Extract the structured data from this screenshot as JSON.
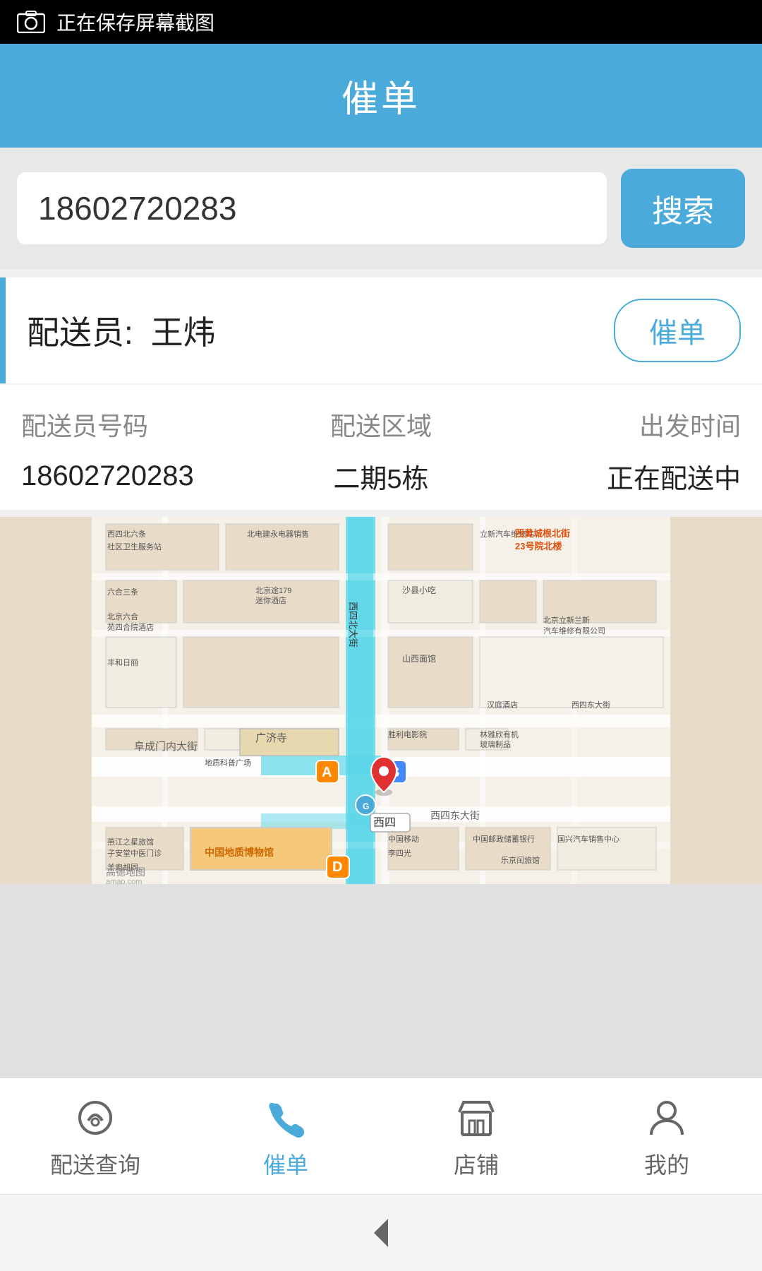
{
  "statusBar": {
    "text": "正在保存屏幕截图"
  },
  "header": {
    "title": "催单"
  },
  "search": {
    "placeholder": "",
    "value": "18602720283",
    "buttonLabel": "搜索"
  },
  "courier": {
    "label": "配送员:",
    "name": "王炜",
    "urgeLabel": "催单"
  },
  "infoTable": {
    "headers": [
      "配送员号码",
      "配送区域",
      "出发时间"
    ],
    "values": [
      "18602720283",
      "二期5栋",
      "正在配送中"
    ]
  },
  "map": {
    "watermark": "高德地图",
    "watermarkSub": "amap.com"
  },
  "bottomNav": {
    "items": [
      {
        "id": "delivery",
        "label": "配送查询",
        "active": false
      },
      {
        "id": "urge",
        "label": "催单",
        "active": true
      },
      {
        "id": "store",
        "label": "店铺",
        "active": false
      },
      {
        "id": "mine",
        "label": "我的",
        "active": false
      }
    ]
  },
  "backBar": {
    "label": "返回"
  }
}
